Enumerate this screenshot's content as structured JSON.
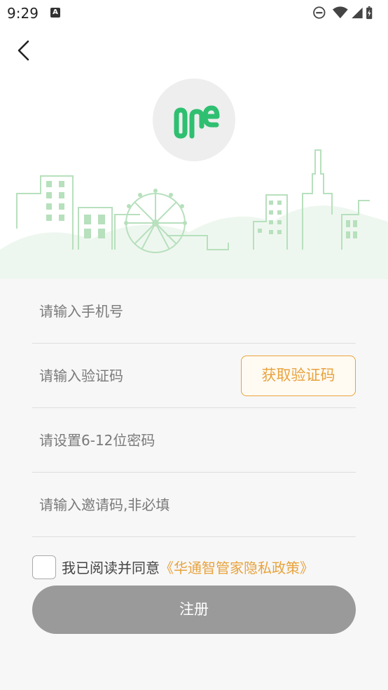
{
  "status_bar": {
    "time": "9:29",
    "left_icon": "A",
    "icons": [
      "do-not-disturb-icon",
      "wifi-icon",
      "signal-icon",
      "battery-icon"
    ]
  },
  "header": {
    "back_icon": "chevron-left-icon",
    "logo_text": "one"
  },
  "form": {
    "phone_placeholder": "请输入手机号",
    "code_placeholder": "请输入验证码",
    "get_code_label": "获取验证码",
    "password_placeholder": "请设置6-12位密码",
    "invite_placeholder": "请输入邀请码,非必填"
  },
  "agreement": {
    "prefix": "我已阅读并同意",
    "link": "《华通智管家隐私政策》"
  },
  "register_label": "注册",
  "colors": {
    "accent": "#e8a33d",
    "brand_green": "#2fbf71",
    "button_disabled": "#9a9a9a",
    "illustration_green": "#9fd9a9"
  }
}
